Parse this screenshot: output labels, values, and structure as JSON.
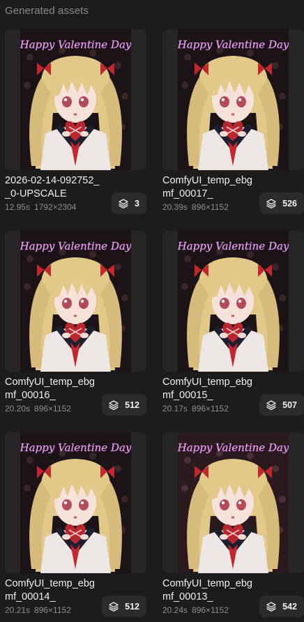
{
  "header": {
    "title": "Generated assets"
  },
  "assets": [
    {
      "name": "2026-02-14-092752_\n_0-UPSCALE",
      "time": "12.95s",
      "dims": "1792×2304",
      "count": "3",
      "variant": "a"
    },
    {
      "name": "ComfyUI_temp_ebg\nmf_00017_",
      "time": "20.39s",
      "dims": "896×1152",
      "count": "526",
      "variant": "a"
    },
    {
      "name": "ComfyUI_temp_ebg\nmf_00016_",
      "time": "20.20s",
      "dims": "896×1152",
      "count": "512",
      "variant": "a"
    },
    {
      "name": "ComfyUI_temp_ebg\nmf_00015_",
      "time": "20.17s",
      "dims": "896×1152",
      "count": "507",
      "variant": "a"
    },
    {
      "name": "ComfyUI_temp_ebg\nmf_00014_",
      "time": "20.21s",
      "dims": "896×1152",
      "count": "512",
      "variant": "a"
    },
    {
      "name": "ComfyUI_temp_ebg\nmf_00013_",
      "time": "20.24s",
      "dims": "896×1152",
      "count": "542",
      "variant": "b"
    }
  ],
  "artwork": {
    "caption": "Happy Valentine Day",
    "icon": "layers-icon",
    "colors": {
      "background": "#1c1c1c",
      "card": "#262626",
      "badge": "#2b2b2b",
      "hair": "#e2c98a",
      "bow": "#c4262e",
      "caption": "#e9b3ef"
    }
  }
}
